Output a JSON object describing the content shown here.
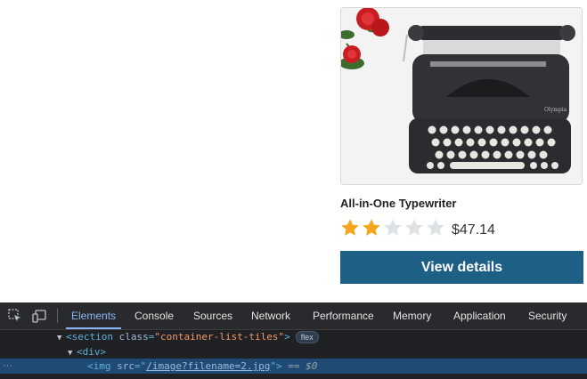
{
  "product": {
    "title": "All-in-One Typewriter",
    "price": "$47.14",
    "rating": 2,
    "rating_max": 5,
    "button_label": "View details",
    "button_color": "#1e5f86",
    "star_filled_color": "#f4a71c",
    "star_empty_color": "#dfe3e6"
  },
  "devtools": {
    "tabs": [
      {
        "label": "Elements",
        "active": true
      },
      {
        "label": "Console",
        "active": false
      },
      {
        "label": "Sources",
        "active": false
      },
      {
        "label": "Network",
        "active": false
      },
      {
        "label": "Performance",
        "active": false
      },
      {
        "label": "Memory",
        "active": false
      },
      {
        "label": "Application",
        "active": false
      },
      {
        "label": "Security",
        "active": false
      }
    ],
    "dom": {
      "section_tag": "section",
      "section_attr": "class",
      "section_value": "\"container-list-tiles\"",
      "flex_badge": "flex",
      "div_tag": "div",
      "img_tag": "img",
      "img_attr": "src",
      "img_value": "/image?filename=2.jpg",
      "eq_marker": "== $0",
      "ellipsis": "···"
    }
  }
}
